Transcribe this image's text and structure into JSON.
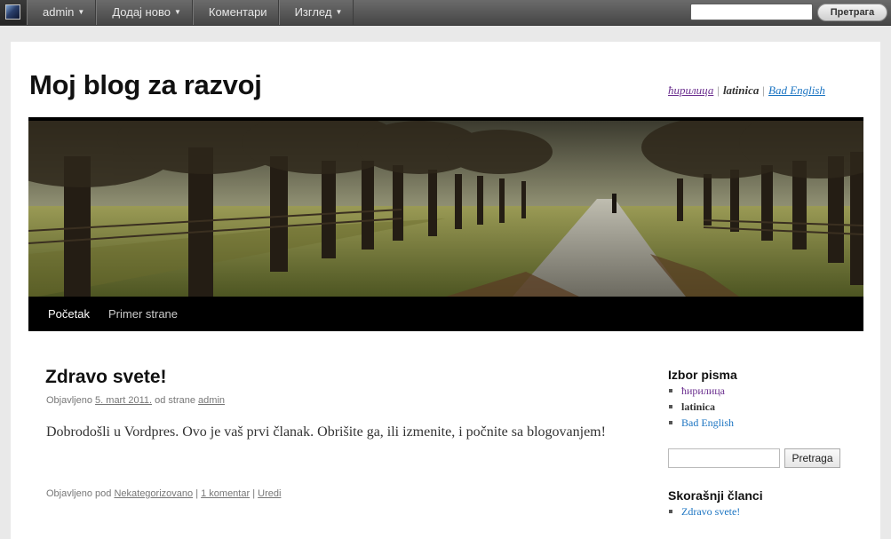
{
  "adminbar": {
    "menu": [
      {
        "label": "admin",
        "dropdown": true
      },
      {
        "label": "Додај ново",
        "dropdown": true
      },
      {
        "label": "Коментари",
        "dropdown": false
      },
      {
        "label": "Изглед",
        "dropdown": true
      }
    ],
    "search_button": "Претрага",
    "search_value": ""
  },
  "site": {
    "title": "Moj blog za razvoj",
    "languages": [
      "ћирилица",
      "latinica",
      "Bad English"
    ]
  },
  "nav": {
    "items": [
      "Početak",
      "Primer strane"
    ]
  },
  "post": {
    "title": "Zdravo svete!",
    "meta_prefix": "Objavljeno",
    "date": "5. mart 2011.",
    "meta_by": "od strane",
    "author": "admin",
    "body": "Dobrodošli u Vordpres. Ovo je vaš prvi članak. Obrišite ga, ili izmenite, i počnite sa blogovanjem!",
    "footer_prefix": "Objavljeno pod",
    "category": "Nekategorizovano",
    "comments": "1 komentar",
    "edit": "Uredi"
  },
  "sidebar": {
    "script_title": "Izbor pisma",
    "script_items": [
      "ћирилица",
      "latinica",
      "Bad English"
    ],
    "search_button": "Pretraga",
    "recent_title": "Skorašnji članci",
    "recent_items": [
      "Zdravo svete!"
    ]
  },
  "colors": {
    "adminbar": "#464646",
    "link_blue": "#1b74c2",
    "link_purple": "#6b2f8f",
    "nav_bg": "#000000"
  }
}
